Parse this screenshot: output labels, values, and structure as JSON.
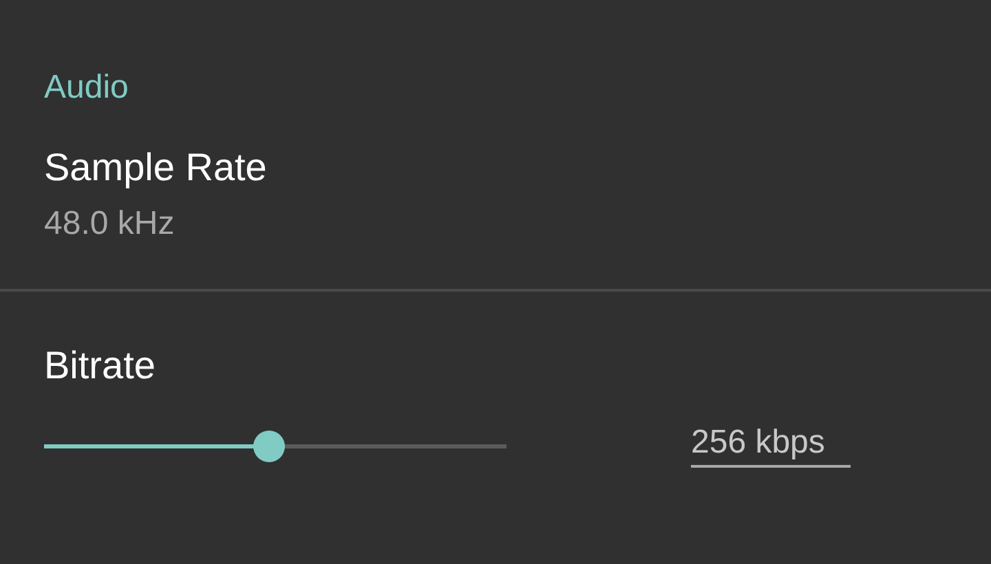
{
  "section": {
    "title": "Audio"
  },
  "sample_rate": {
    "label": "Sample Rate",
    "value": "48.0 kHz"
  },
  "bitrate": {
    "label": "Bitrate",
    "level": 0.485,
    "value": "256 kbps"
  }
}
